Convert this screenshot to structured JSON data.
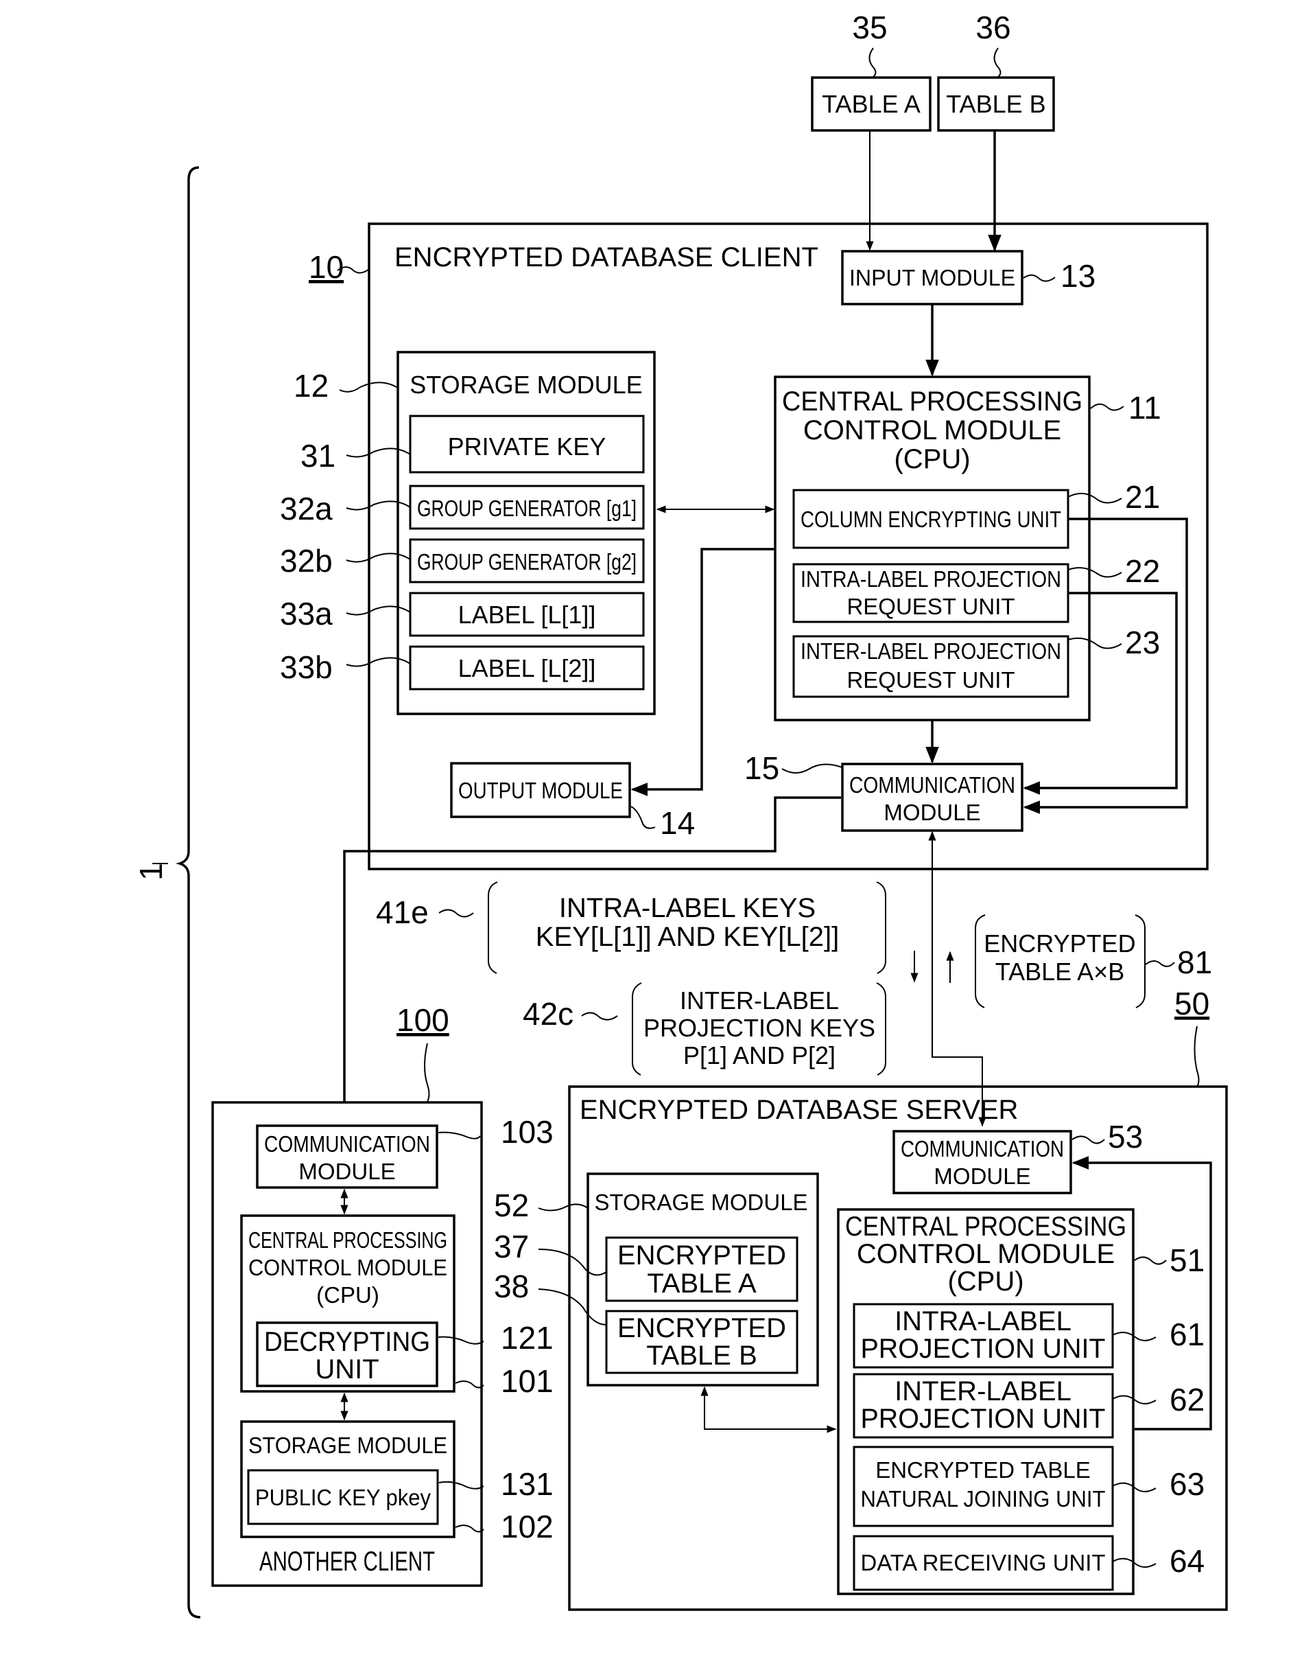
{
  "figure": {
    "system_ref": "1",
    "inputs": [
      {
        "ref": "35",
        "label": "TABLE A"
      },
      {
        "ref": "36",
        "label": "TABLE B"
      }
    ],
    "client": {
      "ref": "10",
      "title": "ENCRYPTED DATABASE CLIENT",
      "input_module": {
        "ref": "13",
        "label": "INPUT MODULE"
      },
      "storage_module": {
        "ref": "12",
        "label": "STORAGE MODULE",
        "items": [
          {
            "ref": "31",
            "label": "PRIVATE KEY"
          },
          {
            "ref": "32a",
            "label": "GROUP GENERATOR [g1]"
          },
          {
            "ref": "32b",
            "label": "GROUP GENERATOR [g2]"
          },
          {
            "ref": "33a",
            "label": "LABEL [L[1]]"
          },
          {
            "ref": "33b",
            "label": "LABEL [L[2]]"
          }
        ]
      },
      "cpu": {
        "ref": "11",
        "label_lines": [
          "CENTRAL PROCESSING",
          "CONTROL MODULE",
          "(CPU)"
        ],
        "units": [
          {
            "ref": "21",
            "lines": [
              "COLUMN ENCRYPTING UNIT"
            ]
          },
          {
            "ref": "22",
            "lines": [
              "INTRA-LABEL PROJECTION",
              "REQUEST UNIT"
            ]
          },
          {
            "ref": "23",
            "lines": [
              "INTER-LABEL PROJECTION",
              "REQUEST UNIT"
            ]
          }
        ]
      },
      "output_module": {
        "ref": "14",
        "label": "OUTPUT MODULE"
      },
      "communication_module": {
        "ref": "15",
        "lines": [
          "COMMUNICATION",
          "MODULE"
        ]
      }
    },
    "messages": [
      {
        "ref": "41e",
        "lines": [
          "INTRA-LABEL KEYS",
          "KEY[L[1]] AND KEY[L[2]]"
        ],
        "direction": "down"
      },
      {
        "ref": "42c",
        "lines": [
          "INTER-LABEL",
          "PROJECTION KEYS",
          "P[1] AND P[2]"
        ],
        "direction": "down"
      },
      {
        "ref": "81",
        "lines": [
          "ENCRYPTED",
          "TABLE A×B"
        ],
        "direction": "up"
      }
    ],
    "another_client": {
      "ref": "100",
      "title": "ANOTHER CLIENT",
      "communication_module": {
        "ref": "103",
        "lines": [
          "COMMUNICATION",
          "MODULE"
        ]
      },
      "cpu": {
        "ref": "101",
        "lines": [
          "CENTRAL PROCESSING",
          "CONTROL MODULE",
          "(CPU)"
        ]
      },
      "decrypting_unit": {
        "ref": "121",
        "lines": [
          "DECRYPTING",
          "UNIT"
        ]
      },
      "storage_module": {
        "ref": "102",
        "label": "STORAGE MODULE"
      },
      "public_key": {
        "ref": "131",
        "label": "PUBLIC KEY pkey"
      }
    },
    "server": {
      "ref": "50",
      "title": "ENCRYPTED DATABASE SERVER",
      "communication_module": {
        "ref": "53",
        "lines": [
          "COMMUNICATION",
          "MODULE"
        ]
      },
      "storage_module": {
        "ref": "52",
        "label": "STORAGE MODULE",
        "items": [
          {
            "ref": "37",
            "lines": [
              "ENCRYPTED",
              "TABLE A"
            ]
          },
          {
            "ref": "38",
            "lines": [
              "ENCRYPTED",
              "TABLE B"
            ]
          }
        ]
      },
      "cpu": {
        "ref": "51",
        "label_lines": [
          "CENTRAL PROCESSING",
          "CONTROL MODULE",
          "(CPU)"
        ],
        "units": [
          {
            "ref": "61",
            "lines": [
              "INTRA-LABEL",
              "PROJECTION UNIT"
            ]
          },
          {
            "ref": "62",
            "lines": [
              "INTER-LABEL",
              "PROJECTION UNIT"
            ]
          },
          {
            "ref": "63",
            "lines": [
              "ENCRYPTED TABLE",
              "NATURAL JOINING UNIT"
            ]
          },
          {
            "ref": "64",
            "lines": [
              "DATA RECEIVING UNIT"
            ]
          }
        ]
      }
    }
  }
}
